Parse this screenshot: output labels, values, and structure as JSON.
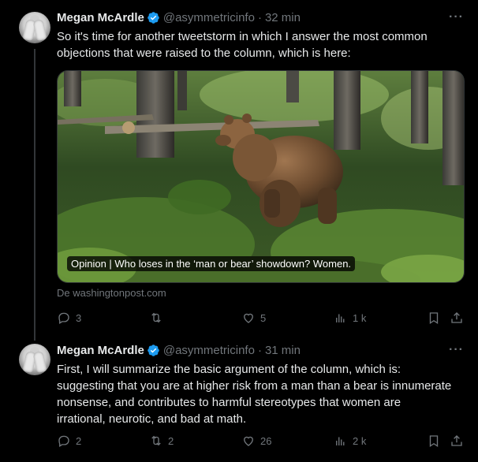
{
  "thread": [
    {
      "author": {
        "name": "Megan McArdle",
        "handle": "@asymmetricinfo",
        "time": "32 min"
      },
      "text_lines": [
        "So it's time for another tweetstorm in which I answer the most common",
        "objections that were raised to the column, which is here:"
      ],
      "card": {
        "title": "Opinion | Who loses in the ‘man or bear’ showdown? Women.",
        "source": "De washingtonpost.com"
      },
      "stats": {
        "replies": "3",
        "reposts": "",
        "likes": "5",
        "views": "1 k"
      }
    },
    {
      "author": {
        "name": "Megan McArdle",
        "handle": "@asymmetricinfo",
        "time": "31 min"
      },
      "text_lines": [
        "First, I will summarize the basic argument of the column, which is:",
        "suggesting that you are at higher risk from a man than a bear is innumerate",
        "nonsense, and contributes to harmful stereotypes that women are",
        "irrational, neurotic, and bad at math."
      ],
      "stats": {
        "replies": "2",
        "reposts": "2",
        "likes": "26",
        "views": "2 k"
      }
    }
  ],
  "ui": {
    "separator": "·",
    "more": "···"
  },
  "colors": {
    "verified": "#1d9bf0",
    "muted": "#71767b",
    "text": "#e7e9ea",
    "background": "#000000"
  }
}
